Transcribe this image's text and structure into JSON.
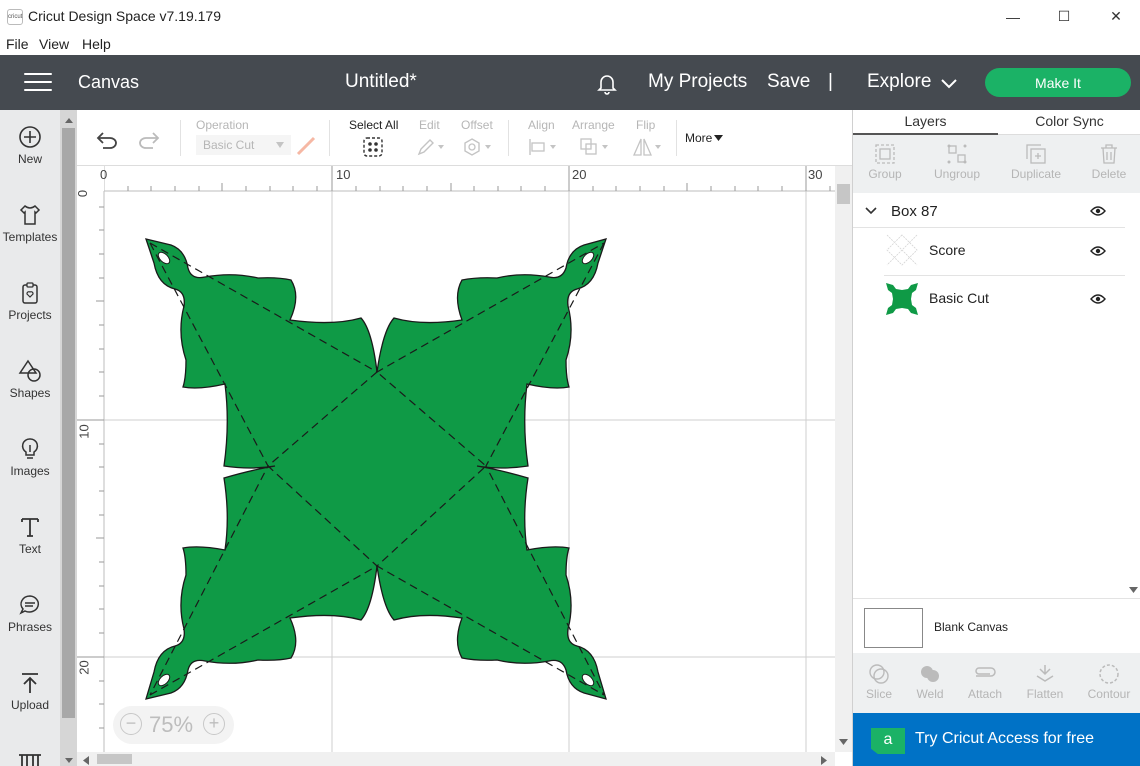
{
  "window": {
    "app_title": "Cricut Design Space  v7.19.179",
    "logo_text": "cricut",
    "minimize": "—",
    "maximize": "☐",
    "close": "✕"
  },
  "menu": [
    "File",
    "View",
    "Help"
  ],
  "header": {
    "section": "Canvas",
    "doc_title": "Untitled*",
    "my_projects": "My Projects",
    "save": "Save",
    "divider": "|",
    "explore": "Explore",
    "make_it": "Make It"
  },
  "sidebar": [
    {
      "label": "New",
      "icon": "plus-circle-icon"
    },
    {
      "label": "Templates",
      "icon": "tshirt-icon"
    },
    {
      "label": "Projects",
      "icon": "clipboard-icon"
    },
    {
      "label": "Shapes",
      "icon": "shapes-icon"
    },
    {
      "label": "Images",
      "icon": "lightbulb-icon"
    },
    {
      "label": "Text",
      "icon": "text-icon"
    },
    {
      "label": "Phrases",
      "icon": "speech-bubble-icon"
    },
    {
      "label": "Upload",
      "icon": "upload-icon"
    }
  ],
  "toolbar": {
    "operation_label": "Operation",
    "operation_value": "Basic Cut",
    "select_all": "Select All",
    "edit": "Edit",
    "offset": "Offset",
    "align": "Align",
    "arrange": "Arrange",
    "flip": "Flip",
    "more": "More"
  },
  "ruler": {
    "top_labels": [
      "0",
      "10",
      "20",
      "30"
    ],
    "left_labels": [
      "0",
      "10",
      "20"
    ]
  },
  "zoom": {
    "minus": "−",
    "value": "75%",
    "plus": "+"
  },
  "canvas": {
    "fill_color": "#0f9a46",
    "outline_color": "#1a1a1a"
  },
  "right_panel": {
    "tabs": [
      "Layers",
      "Color Sync"
    ],
    "actions": [
      "Group",
      "Ungroup",
      "Duplicate",
      "Delete"
    ],
    "group_name": "Box 87",
    "layers": [
      "Score",
      "Basic Cut"
    ],
    "blank_canvas": "Blank Canvas",
    "bottom_actions": [
      "Slice",
      "Weld",
      "Attach",
      "Flatten",
      "Contour"
    ],
    "banner": "Try Cricut Access for free",
    "banner_logo": "a"
  }
}
